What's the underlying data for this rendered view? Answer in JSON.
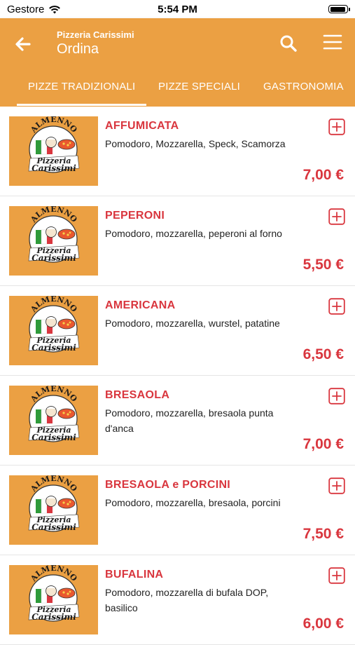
{
  "status_bar": {
    "carrier": "Gestore",
    "time": "5:54 PM"
  },
  "header": {
    "subtitle": "Pizzeria Carissimi",
    "title": "Ordina"
  },
  "tabs": [
    {
      "label": "PIZZE TRADIZIONALI"
    },
    {
      "label": "PIZZE SPECIALI"
    },
    {
      "label": "GASTRONOMIA"
    }
  ],
  "logo": {
    "top_text": "ALMENNO",
    "line1": "Pizzeria",
    "line2": "Carissimi"
  },
  "items": [
    {
      "name": "AFFUMICATA",
      "description": "Pomodoro, Mozzarella, Speck, Scamorza",
      "price": "7,00 €"
    },
    {
      "name": "PEPERONI",
      "description": "Pomodoro, mozzarella, peperoni al forno",
      "price": "5,50 €"
    },
    {
      "name": "AMERICANA",
      "description": "Pomodoro, mozzarella, wurstel, patatine",
      "price": "6,50 €"
    },
    {
      "name": "BRESAOLA",
      "description": "Pomodoro, mozzarella, bresaola punta d'anca",
      "price": "7,00 €"
    },
    {
      "name": "BRESAOLA e PORCINI",
      "description": "Pomodoro, mozzarella, bresaola, porcini",
      "price": "7,50 €"
    },
    {
      "name": "BUFALINA",
      "description": "Pomodoro, mozzarella di bufala DOP, basilico",
      "price": "6,00 €"
    }
  ],
  "colors": {
    "primary": "#EBA043",
    "accent": "#D9363E"
  },
  "icons": {
    "back": "arrow-left-icon",
    "search": "search-icon",
    "menu": "menu-icon",
    "add": "plus-square-icon"
  }
}
